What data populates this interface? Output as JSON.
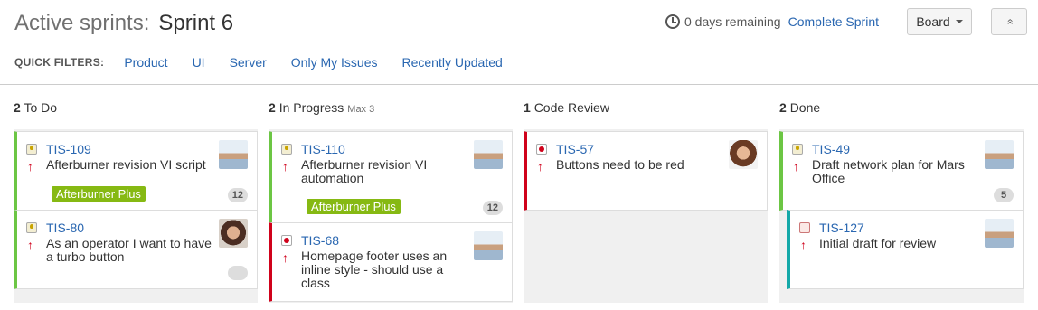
{
  "header": {
    "title_prefix": "Active sprints:",
    "sprint_name": "Sprint 6",
    "remaining": "0 days remaining",
    "complete_sprint": "Complete Sprint",
    "board_button": "Board",
    "collapse_button": "»"
  },
  "filters": {
    "label": "QUICK FILTERS:",
    "items": [
      "Product",
      "UI",
      "Server",
      "Only My Issues",
      "Recently Updated"
    ]
  },
  "columns": [
    {
      "count": "2",
      "name": "To Do",
      "max": ""
    },
    {
      "count": "2",
      "name": "In Progress",
      "max": "Max 3"
    },
    {
      "count": "1",
      "name": "Code Review",
      "max": ""
    },
    {
      "count": "2",
      "name": "Done",
      "max": ""
    }
  ],
  "cards": [
    {
      "key": "TIS-109",
      "summary": "Afterburner revision VI script",
      "epic": "Afterburner Plus",
      "estimate": "12",
      "priority": "↑",
      "type_icon": "idea-icon",
      "status_color": "#6cc644"
    },
    {
      "key": "TIS-80",
      "summary": "As an operator I want to have a turbo button",
      "epic": "",
      "estimate": "",
      "priority": "↑",
      "type_icon": "idea-icon",
      "status_color": "#6cc644"
    },
    {
      "key": "TIS-110",
      "summary": "Afterburner revision VI automation",
      "epic": "Afterburner Plus",
      "estimate": "12",
      "priority": "↑",
      "type_icon": "idea-icon",
      "status_color": "#6cc644"
    },
    {
      "key": "TIS-68",
      "summary": "Homepage footer uses an inline style - should use a class",
      "epic": "",
      "estimate": "",
      "priority": "↑",
      "type_icon": "bug-icon",
      "status_color": "#d0021b"
    },
    {
      "key": "TIS-57",
      "summary": "Buttons need to be red",
      "epic": "",
      "estimate": "",
      "priority": "↑",
      "type_icon": "bug-icon",
      "status_color": "#d0021b"
    },
    {
      "key": "TIS-49",
      "summary": "Draft network plan for Mars Office",
      "epic": "",
      "estimate": "5",
      "priority": "↑",
      "type_icon": "idea-icon",
      "status_color": "#6cc644"
    },
    {
      "key": "TIS-127",
      "summary": "Initial draft for review",
      "epic": "",
      "estimate": "",
      "priority": "↑",
      "type_icon": "subtask-icon",
      "status_color": "#14a8a8"
    }
  ]
}
